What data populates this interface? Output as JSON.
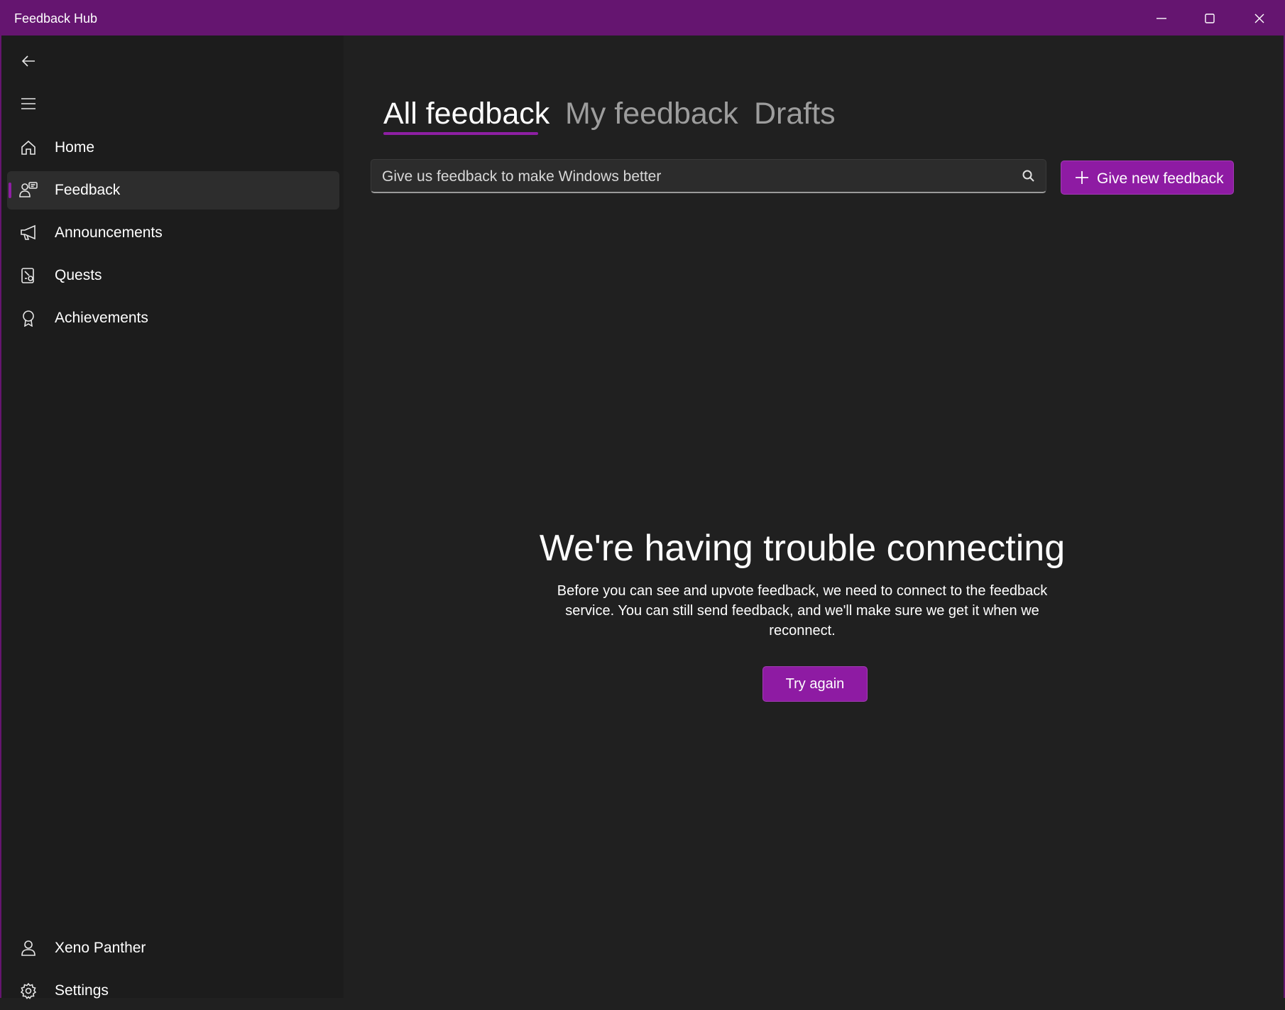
{
  "window": {
    "title": "Feedback Hub",
    "accent_color": "#651570",
    "button_color": "#8e1ba3"
  },
  "sidebar": {
    "back_icon": "back-arrow-icon",
    "menu_icon": "hamburger-icon",
    "items": [
      {
        "label": "Home",
        "icon": "home-icon",
        "selected": false
      },
      {
        "label": "Feedback",
        "icon": "feedback-icon",
        "selected": true
      },
      {
        "label": "Announcements",
        "icon": "megaphone-icon",
        "selected": false
      },
      {
        "label": "Quests",
        "icon": "quests-icon",
        "selected": false
      },
      {
        "label": "Achievements",
        "icon": "badge-icon",
        "selected": false
      }
    ],
    "footer": [
      {
        "label": "Xeno Panther",
        "icon": "person-icon"
      },
      {
        "label": "Settings",
        "icon": "gear-icon"
      }
    ]
  },
  "main": {
    "tabs": [
      {
        "label": "All feedback",
        "active": true
      },
      {
        "label": "My feedback",
        "active": false
      },
      {
        "label": "Drafts",
        "active": false
      }
    ],
    "search": {
      "placeholder": "Give us feedback to make Windows better",
      "value": ""
    },
    "new_feedback_label": "Give new feedback",
    "error": {
      "title": "We're having trouble connecting",
      "body": "Before you can see and upvote feedback, we need to connect to the feedback service. You can still send feedback, and we'll make sure we get it when we reconnect.",
      "retry_label": "Try again"
    }
  }
}
